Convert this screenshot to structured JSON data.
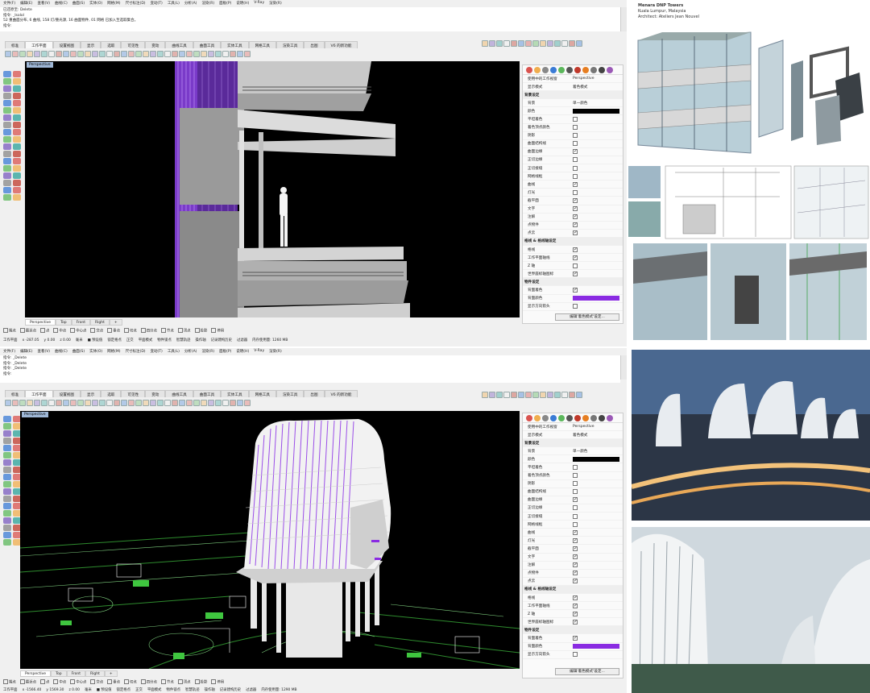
{
  "window1": {
    "menu": [
      "文件(F)",
      "编辑(E)",
      "查看(V)",
      "曲线(C)",
      "曲面(S)",
      "实体(O)",
      "网格(M)",
      "尺寸标注(D)",
      "变动(T)",
      "工具(L)",
      "分析(A)",
      "渲染(R)",
      "面板(P)",
      "说明(H)",
      "V-Ray",
      "渲染(R)"
    ],
    "cmd": [
      "已还原至: Delete",
      "指令: _Isolol",
      "52 重曲面分布, 6 曲线, 158 灯/重光源, 16 曲面物件, 01 网格 已加入至选取集合。",
      "指令:"
    ],
    "tabs": [
      "标准",
      "工作平面",
      "设置视图",
      "显示",
      "选取",
      "可见性",
      "变动",
      "曲线工具",
      "曲面工具",
      "实体工具",
      "网格工具",
      "渲染工具",
      "出图",
      "V6 的新功能"
    ],
    "viewport_label": "Perspective",
    "vp_tabs": [
      "Perspective",
      "Top",
      "Front",
      "Right",
      "+"
    ],
    "osnap": [
      "端点",
      "最近点",
      "点",
      "中点",
      "中心点",
      "交点",
      "垂点",
      "切点",
      "四分点",
      "节点",
      "顶点",
      "投影",
      "停用"
    ],
    "status": [
      "工作平面",
      "x -287.05",
      "y 0.00",
      "z 0.00",
      "毫米",
      "■ 预设值",
      "锁定格点",
      "正交",
      "平面模式",
      "物件锁点",
      "智慧轨迹",
      "操作轴",
      "记录建构历史",
      "过滤器",
      "内存使用量: 1260 MB"
    ]
  },
  "window2": {
    "menu": [
      "文件(F)",
      "编辑(E)",
      "查看(V)",
      "曲线(C)",
      "曲面(S)",
      "实体(O)",
      "网格(M)",
      "尺寸标注(D)",
      "变动(T)",
      "工具(L)",
      "分析(A)",
      "渲染(R)",
      "面板(P)",
      "说明(H)",
      "V-Ray",
      "渲染(R)"
    ],
    "cmd": [
      "指令: _Delete",
      "指令: _Delete",
      "指令: _Delete",
      "指令:"
    ],
    "tabs": [
      "标准",
      "工作平面",
      "设置视图",
      "显示",
      "选取",
      "可见性",
      "变动",
      "曲线工具",
      "曲面工具",
      "实体工具",
      "网格工具",
      "渲染工具",
      "出图",
      "V6 的新功能"
    ],
    "viewport_label": "Perspective",
    "vp_tabs": [
      "Perspective",
      "Top",
      "Front",
      "Right",
      "+"
    ],
    "osnap": [
      "端点",
      "最近点",
      "点",
      "中点",
      "中心点",
      "交点",
      "垂点",
      "切点",
      "四分点",
      "节点",
      "顶点",
      "投影",
      "停用"
    ],
    "status": [
      "工作平面",
      "x -1566.40",
      "y 1569.30",
      "z 0.00",
      "毫米",
      "■ 预设值",
      "锁定格点",
      "正交",
      "平面模式",
      "物件锁点",
      "智慧轨迹",
      "操作轴",
      "记录建构历史",
      "过滤器",
      "内存使用量: 1290 MB"
    ]
  },
  "panel1": {
    "rows": [
      {
        "t": "row",
        "label": "使用中的工作视窗",
        "val": "Perspective"
      },
      {
        "t": "row",
        "label": "显示模式",
        "val": "着色模式"
      },
      {
        "t": "sec",
        "label": "背景设定"
      },
      {
        "t": "row",
        "label": "背景",
        "val": "单一颜色"
      },
      {
        "t": "swatch",
        "label": "颜色",
        "color": "#000000"
      },
      {
        "t": "chk",
        "label": "平坦着色",
        "on": false
      },
      {
        "t": "chk",
        "label": "着色顶点颜色",
        "on": false
      },
      {
        "t": "chk",
        "label": "阴影",
        "on": false
      },
      {
        "t": "chk",
        "label": "曲面结构线",
        "on": false
      },
      {
        "t": "chk",
        "label": "曲面边缘",
        "on": true
      },
      {
        "t": "chk",
        "label": "正切边缘",
        "on": false
      },
      {
        "t": "chk",
        "label": "正切接缝",
        "on": false
      },
      {
        "t": "chk",
        "label": "网格线框",
        "on": false
      },
      {
        "t": "chk",
        "label": "曲线",
        "on": true
      },
      {
        "t": "chk",
        "label": "灯光",
        "on": false
      },
      {
        "t": "chk",
        "label": "截平面",
        "on": true
      },
      {
        "t": "chk",
        "label": "文字",
        "on": true
      },
      {
        "t": "chk",
        "label": "注解",
        "on": true
      },
      {
        "t": "chk",
        "label": "点物件",
        "on": true
      },
      {
        "t": "chk",
        "label": "点云",
        "on": true
      },
      {
        "t": "sec",
        "label": "格线 & 格线轴设定"
      },
      {
        "t": "chk",
        "label": "格线",
        "on": true
      },
      {
        "t": "chk",
        "label": "工作平面轴线",
        "on": true
      },
      {
        "t": "chk",
        "label": "Z 轴",
        "on": false
      },
      {
        "t": "chk",
        "label": "世界座标轴图标",
        "on": true
      },
      {
        "t": "sec",
        "label": "物件设定"
      },
      {
        "t": "chk",
        "label": "背面着色",
        "on": true
      },
      {
        "t": "swatch",
        "label": "背面颜色",
        "color": "#8a2be2"
      },
      {
        "t": "chk",
        "label": "显示方向箭头",
        "on": false
      }
    ],
    "button": "编辑'着色模式'设定..."
  },
  "panel2": {
    "rows": [
      {
        "t": "row",
        "label": "使用中的工作视窗",
        "val": "Perspective"
      },
      {
        "t": "row",
        "label": "显示模式",
        "val": "着色模式"
      },
      {
        "t": "sec",
        "label": "背景设定"
      },
      {
        "t": "row",
        "label": "背景",
        "val": "单一颜色"
      },
      {
        "t": "swatch",
        "label": "颜色",
        "color": "#000000"
      },
      {
        "t": "chk",
        "label": "平坦着色",
        "on": false
      },
      {
        "t": "chk",
        "label": "着色顶点颜色",
        "on": false
      },
      {
        "t": "chk",
        "label": "阴影",
        "on": false
      },
      {
        "t": "chk",
        "label": "曲面结构线",
        "on": false
      },
      {
        "t": "chk",
        "label": "曲面边缘",
        "on": true
      },
      {
        "t": "chk",
        "label": "正切边缘",
        "on": false
      },
      {
        "t": "chk",
        "label": "正切接缝",
        "on": false
      },
      {
        "t": "chk",
        "label": "网格线框",
        "on": false
      },
      {
        "t": "chk",
        "label": "曲线",
        "on": true
      },
      {
        "t": "chk",
        "label": "灯光",
        "on": true
      },
      {
        "t": "chk",
        "label": "截平面",
        "on": true
      },
      {
        "t": "chk",
        "label": "文字",
        "on": true
      },
      {
        "t": "chk",
        "label": "注解",
        "on": true
      },
      {
        "t": "chk",
        "label": "点物件",
        "on": true
      },
      {
        "t": "chk",
        "label": "点云",
        "on": true
      },
      {
        "t": "sec",
        "label": "格线 & 格线轴设定"
      },
      {
        "t": "chk",
        "label": "格线",
        "on": true
      },
      {
        "t": "chk",
        "label": "工作平面轴线",
        "on": true
      },
      {
        "t": "chk",
        "label": "Z 轴",
        "on": true
      },
      {
        "t": "chk",
        "label": "世界座标轴图标",
        "on": true
      },
      {
        "t": "sec",
        "label": "物件设定"
      },
      {
        "t": "chk",
        "label": "背面着色",
        "on": true
      },
      {
        "t": "swatch",
        "label": "背面颜色",
        "color": "#8a2be2"
      },
      {
        "t": "chk",
        "label": "显示方向箭头",
        "on": false
      }
    ],
    "button": "编辑'着色模式'设定..."
  },
  "caption": {
    "title": "Menara DNP Towers",
    "location": "Kuala Lumpur, Malaysia",
    "architect": "Architect: Ateliers Jean Nouvel"
  },
  "colors": {
    "accent": "#8a2be2",
    "viewport_bg": "#000000",
    "panel_bg": "#fafafa"
  }
}
